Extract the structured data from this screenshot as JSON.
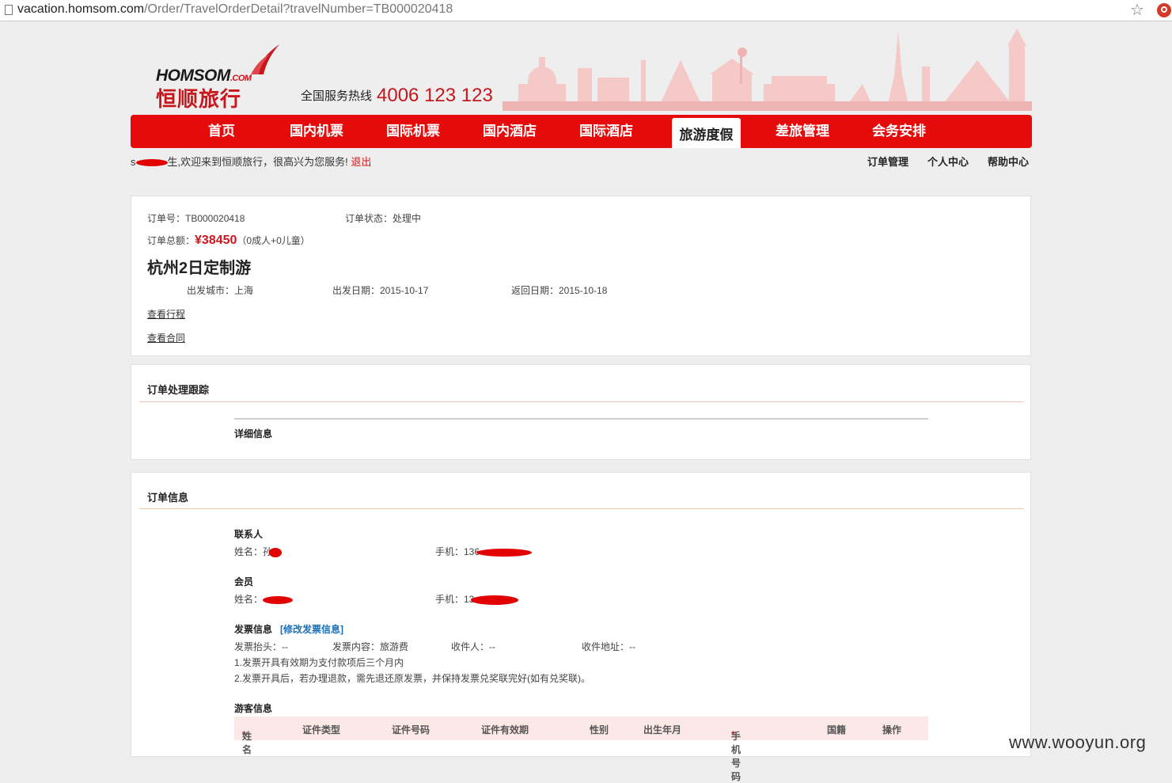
{
  "browser": {
    "url_host": "vacation.homsom.com",
    "url_path": "/Order/TravelOrderDetail?travelNumber=TB000020418"
  },
  "header": {
    "logo_en": "HOMSOM",
    "logo_com": ".COM",
    "logo_cn": "恒顺旅行",
    "hotline_label": "全国服务热线",
    "hotline_number": "4006 123 123"
  },
  "nav": {
    "items": [
      {
        "label": "首页"
      },
      {
        "label": "国内机票"
      },
      {
        "label": "国际机票"
      },
      {
        "label": "国内酒店"
      },
      {
        "label": "国际酒店"
      },
      {
        "label": "旅游度假",
        "active": true
      },
      {
        "label": "差旅管理"
      },
      {
        "label": "会务安排"
      }
    ]
  },
  "welcome": {
    "prefix": "s",
    "text": "生,欢迎来到恒顺旅行，很高兴为您服务!",
    "logout": "退出"
  },
  "top_links": [
    "订单管理",
    "个人中心",
    "帮助中心"
  ],
  "order": {
    "number_label": "订单号：TB000020418",
    "status_label": "订单状态：处理中",
    "total_label": "订单总额：",
    "total_price": "¥38450",
    "total_note": "（0成人+0儿童）",
    "title": "杭州2日定制游",
    "departure_city": "出发城市：上海",
    "departure_date": "出发日期：2015-10-17",
    "return_date": "返回日期：2015-10-18",
    "view_itinerary": "查看行程",
    "view_contract": "查看合同"
  },
  "tracking": {
    "title": "订单处理跟踪",
    "detail_label": "详细信息"
  },
  "order_info": {
    "title": "订单信息",
    "contact": {
      "heading": "联系人",
      "name_label": "姓名：孙",
      "phone_label": "手机：136"
    },
    "member": {
      "heading": "会员",
      "name_label": "姓名：",
      "phone_label": "手机：13"
    },
    "invoice": {
      "heading": "发票信息",
      "edit_link": "[修改发票信息]",
      "title_field": "发票抬头：--",
      "content_field": "发票内容：旅游费",
      "receiver_field": "收件人：--",
      "address_field": "收件地址：--",
      "note1": "1.发票开具有效期为支付款项后三个月内",
      "note2": "2.发票开具后，若办理退款，需先退还原发票，并保持发票兑奖联完好(如有兑奖联)。"
    },
    "travelers": {
      "heading": "游客信息",
      "columns": [
        "姓名",
        "证件类型",
        "证件号码",
        "证件有效期",
        "性别",
        "出生年月",
        "手机号码",
        "国籍",
        "操作"
      ],
      "required_mark": "*"
    }
  },
  "watermark": "www.wooyun.org",
  "colors": {
    "brand_red": "#e50b0b",
    "price_red": "#d2161d",
    "link_blue": "#1b6fb8",
    "table_header_bg": "#fde8e8"
  }
}
